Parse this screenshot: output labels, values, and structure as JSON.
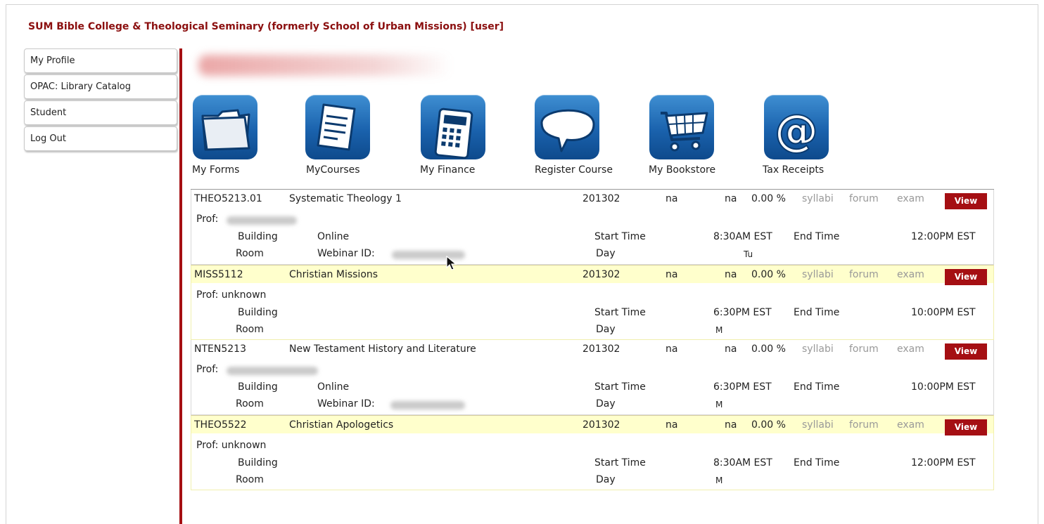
{
  "header": {
    "title": "SUM Bible College & Theological Seminary (formerly School of Urban Missions) [user]"
  },
  "sidebar": {
    "items": [
      {
        "label": "My Profile"
      },
      {
        "label": "OPAC: Library Catalog"
      },
      {
        "label": "Student"
      },
      {
        "label": "Log Out"
      }
    ]
  },
  "apps": [
    {
      "label": "My Forms",
      "icon": "folder-icon"
    },
    {
      "label": "MyCourses",
      "icon": "document-icon"
    },
    {
      "label": "My Finance",
      "icon": "calculator-icon"
    },
    {
      "label": "Register Course",
      "icon": "speech-bubble-icon"
    },
    {
      "label": "My Bookstore",
      "icon": "shopping-cart-icon"
    },
    {
      "label": "Tax Receipts",
      "icon": "at-sign-icon"
    }
  ],
  "labels": {
    "prof": "Prof:",
    "building": "Building",
    "room": "Room",
    "start_time": "Start Time",
    "end_time": "End Time",
    "day": "Day",
    "webinar": "Webinar ID:",
    "syllabi": "syllabi",
    "forum": "forum",
    "exam": "exam",
    "view": "View"
  },
  "courses": [
    {
      "code": "THEO5213.01",
      "name": "Systematic Theology 1",
      "term": "201302",
      "col1": "na",
      "col2": "na",
      "percent": "0.00 %",
      "prof": "",
      "building": "Online",
      "start": "8:30AM EST",
      "end": "12:00PM EST",
      "day": "Tu",
      "highlighted": false
    },
    {
      "code": "MISS5112",
      "name": "Christian Missions",
      "term": "201302",
      "col1": "na",
      "col2": "na",
      "percent": "0.00 %",
      "prof": "Prof: unknown",
      "building": "",
      "start": "6:30PM EST",
      "end": "10:00PM EST",
      "day": "M",
      "highlighted": true
    },
    {
      "code": "NTEN5213",
      "name": "New Testament History and Literature",
      "term": "201302",
      "col1": "na",
      "col2": "na",
      "percent": "0.00 %",
      "prof": "",
      "building": "Online",
      "start": "6:30PM EST",
      "end": "10:00PM EST",
      "day": "M",
      "highlighted": false
    },
    {
      "code": "THEO5522",
      "name": "Christian Apologetics",
      "term": "201302",
      "col1": "na",
      "col2": "na",
      "percent": "0.00 %",
      "prof": "Prof: unknown",
      "building": "",
      "start": "8:30AM EST",
      "end": "12:00PM EST",
      "day": "M",
      "highlighted": true
    }
  ],
  "colors": {
    "brand": "#8b0f0f",
    "accent": "#a50f13",
    "icon_blue": "#1a62ad",
    "highlight_row": "#ffffcc"
  }
}
